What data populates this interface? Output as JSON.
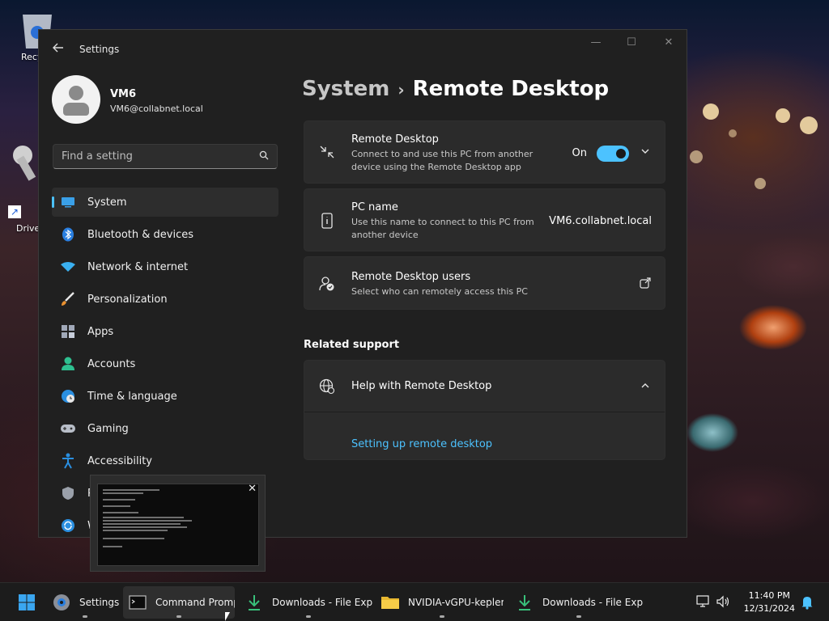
{
  "desktop": {
    "recycle_label": "Recy",
    "driver_label": "Drive"
  },
  "window": {
    "title": "Settings",
    "minimize_glyph": "—",
    "maximize_glyph": "☐",
    "close_glyph": "✕"
  },
  "user": {
    "name": "VM6",
    "email": "VM6@collabnet.local"
  },
  "search": {
    "placeholder": "Find a setting"
  },
  "nav": {
    "items": [
      {
        "label": "System"
      },
      {
        "label": "Bluetooth & devices"
      },
      {
        "label": "Network & internet"
      },
      {
        "label": "Personalization"
      },
      {
        "label": "Apps"
      },
      {
        "label": "Accounts"
      },
      {
        "label": "Time & language"
      },
      {
        "label": "Gaming"
      },
      {
        "label": "Accessibility"
      },
      {
        "label": "P"
      },
      {
        "label": "W"
      }
    ]
  },
  "breadcrumb": {
    "parent": "System",
    "separator": "›",
    "current": "Remote Desktop"
  },
  "cards": {
    "remote_desktop": {
      "title": "Remote Desktop",
      "desc": "Connect to and use this PC from another device using the Remote Desktop app",
      "toggle_label": "On"
    },
    "pc_name": {
      "title": "PC name",
      "desc": "Use this name to connect to this PC from another device",
      "value": "VM6.collabnet.local"
    },
    "rd_users": {
      "title": "Remote Desktop users",
      "desc": "Select who can remotely access this PC"
    }
  },
  "related": {
    "section_label": "Related support",
    "help_title": "Help with Remote Desktop",
    "link_text": "Setting up remote desktop"
  },
  "taskbar": {
    "items": [
      {
        "label": "Settings"
      },
      {
        "label": "Command Promp"
      },
      {
        "label": "Downloads - File Expl"
      },
      {
        "label": "NVIDIA-vGPU-kepler-"
      },
      {
        "label": "Downloads - File Expl"
      }
    ],
    "time": "11:40 PM",
    "date": "12/31/2024"
  },
  "colors": {
    "accent": "#4cc2ff",
    "window_bg": "#202020",
    "card_bg": "#2b2b2b"
  }
}
